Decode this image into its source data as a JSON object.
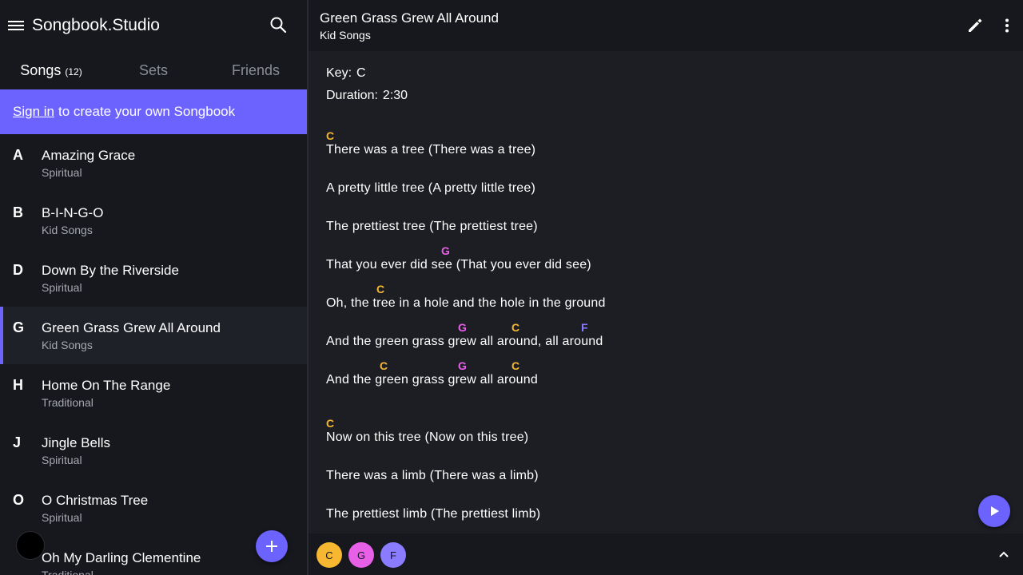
{
  "app": {
    "title": "Songbook.Studio"
  },
  "tabs": [
    {
      "label": "Songs",
      "count": "(12)"
    },
    {
      "label": "Sets"
    },
    {
      "label": "Friends"
    }
  ],
  "banner": {
    "link": "Sign in",
    "text": "to create your own Songbook"
  },
  "songs": [
    {
      "letter": "A",
      "title": "Amazing Grace",
      "category": "Spiritual"
    },
    {
      "letter": "B",
      "title": "B-I-N-G-O",
      "category": "Kid Songs"
    },
    {
      "letter": "D",
      "title": "Down By the Riverside",
      "category": "Spiritual"
    },
    {
      "letter": "G",
      "title": "Green Grass Grew All Around",
      "category": "Kid Songs"
    },
    {
      "letter": "H",
      "title": "Home On The Range",
      "category": "Traditional"
    },
    {
      "letter": "J",
      "title": "Jingle Bells",
      "category": "Spiritual"
    },
    {
      "letter": "O",
      "title": "O Christmas Tree",
      "category": "Spiritual"
    },
    {
      "letter": "",
      "title": "Oh My Darling Clementine",
      "category": "Traditional"
    }
  ],
  "song": {
    "title": "Green Grass Grew All Around",
    "category": "Kid Songs",
    "key_label": "Key:",
    "key": "C",
    "duration_label": "Duration:",
    "duration": "2:30",
    "lines": [
      "There was a tree (There was a tree)",
      "A pretty little tree (A pretty little tree)",
      "The prettiest tree (The prettiest tree)",
      "That you ever did see (That you ever did see)",
      "Oh, the tree in a hole and the hole in the ground",
      "And the green grass grew all around, all around",
      "And the green grass grew all around",
      "Now on this tree (Now on this tree)",
      "There was a limb (There was a limb)",
      "The prettiest limb (The prettiest limb)"
    ],
    "chords": [
      "C",
      "G",
      "C",
      "G",
      "C",
      "F",
      "C",
      "G",
      "C",
      "C"
    ]
  },
  "chord_bar": [
    {
      "name": "C",
      "color": "#f7b731"
    },
    {
      "name": "G",
      "color": "#e85fe8"
    },
    {
      "name": "F",
      "color": "#8b7cff"
    }
  ],
  "colors": {
    "accent": "#6c63ff",
    "chord_c": "#f7b731",
    "chord_g": "#e85fe8",
    "chord_f": "#8b7cff"
  }
}
